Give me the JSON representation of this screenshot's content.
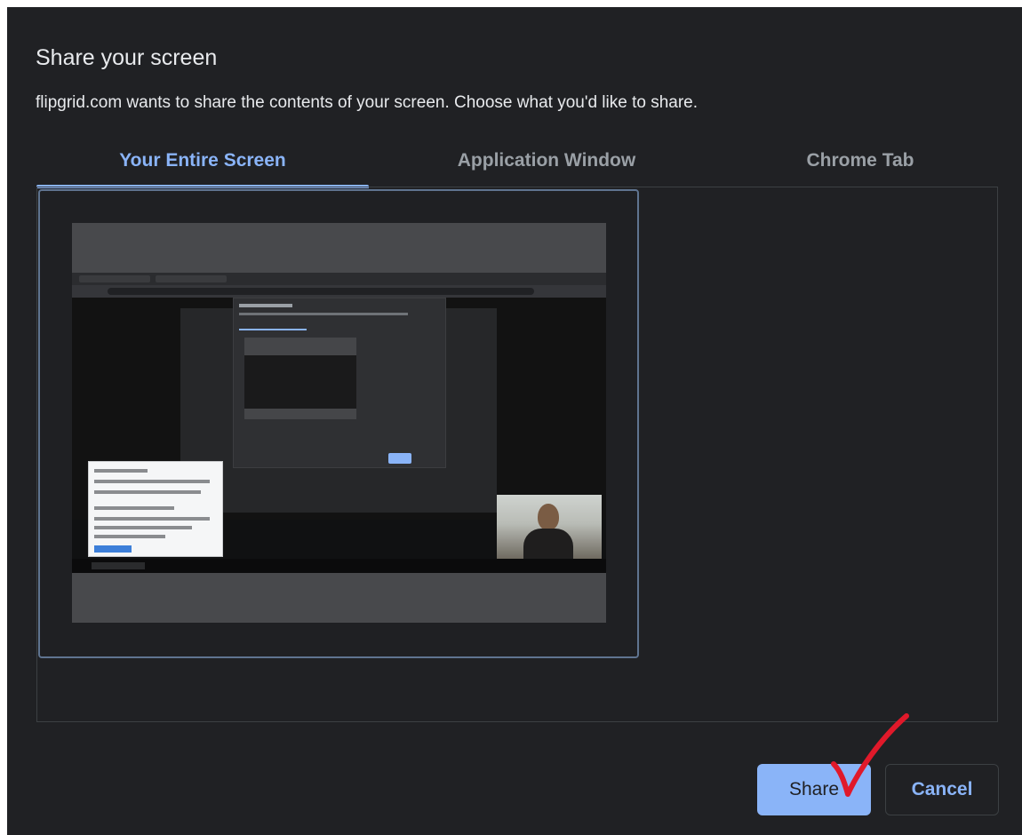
{
  "dialog": {
    "title": "Share your screen",
    "subtitle": "flipgrid.com wants to share the contents of your screen. Choose what you'd like to share."
  },
  "tabs": [
    {
      "label": "Your Entire Screen",
      "selected": true
    },
    {
      "label": "Application Window",
      "selected": false
    },
    {
      "label": "Chrome Tab",
      "selected": false
    }
  ],
  "buttons": {
    "share_label": "Share",
    "cancel_label": "Cancel"
  },
  "colors": {
    "background": "#202124",
    "accent": "#8ab4f8",
    "text": "#e8eaed",
    "inactive_tab": "#9aa0a6",
    "annotation": "#e0192a"
  },
  "annotation": {
    "icon": "checkmark-icon"
  }
}
